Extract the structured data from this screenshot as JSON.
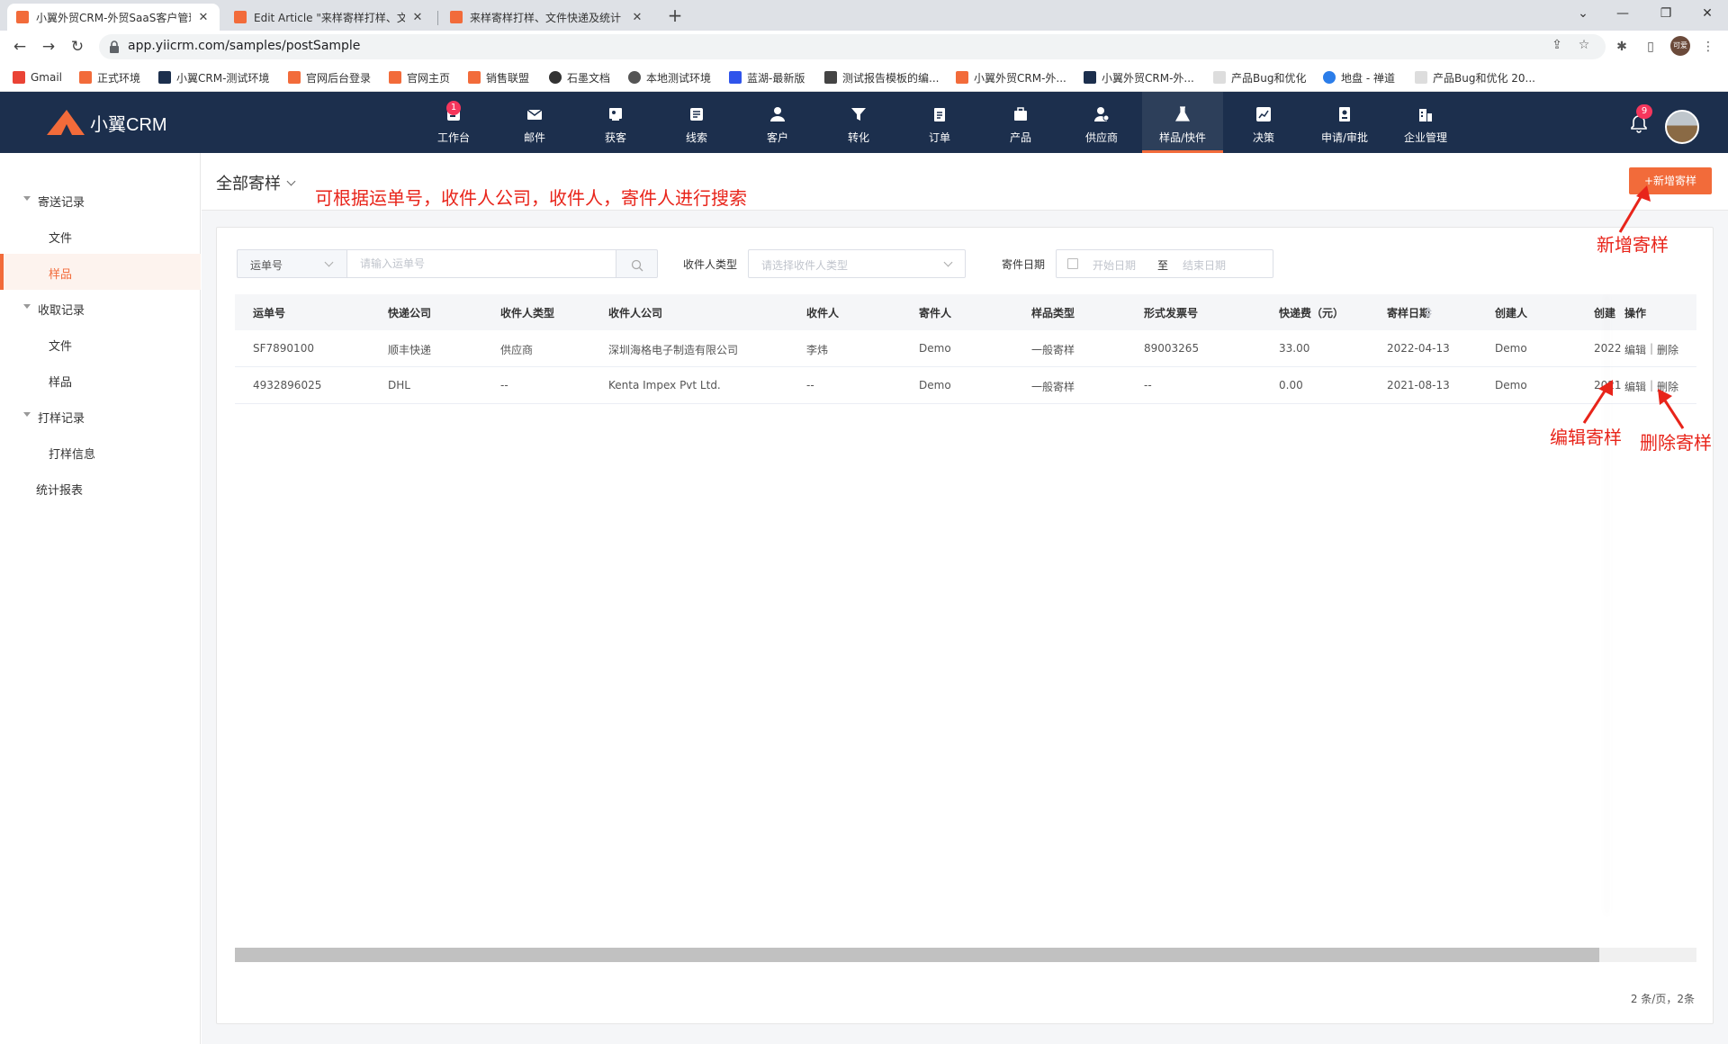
{
  "browser": {
    "tabs": [
      {
        "title": "小翼外贸CRM-外贸SaaS客户管理",
        "active": true
      },
      {
        "title": "Edit Article \"来样寄样打样、文件\"",
        "active": false
      },
      {
        "title": "来样寄样打样、文件快递及统计 -",
        "active": false
      }
    ],
    "new_tab": "+",
    "url": "app.yiicrm.com/samples/postSample",
    "profile_label": "可爱",
    "bookmarks": [
      {
        "label": "Gmail",
        "color": "#ea4335"
      },
      {
        "label": "正式环境",
        "color": "#f26b3a"
      },
      {
        "label": "小翼CRM-测试环境",
        "color": "#1c2f4d"
      },
      {
        "label": "官网后台登录",
        "color": "#f26b3a"
      },
      {
        "label": "官网主页",
        "color": "#f26b3a"
      },
      {
        "label": "销售联盟",
        "color": "#f26b3a"
      },
      {
        "label": "石墨文档",
        "color": "#333333"
      },
      {
        "label": "本地测试环境",
        "color": "#555555"
      },
      {
        "label": "蓝湖-最新版",
        "color": "#2f54eb"
      },
      {
        "label": "测试报告模板的编...",
        "color": "#444444"
      },
      {
        "label": "小翼外贸CRM-外...",
        "color": "#f26b3a"
      },
      {
        "label": "小翼外贸CRM-外...",
        "color": "#1c2f4d"
      },
      {
        "label": "产品Bug和优化",
        "color": "#dddddd"
      },
      {
        "label": "地盘 - 禅道",
        "color": "#2b7de9"
      },
      {
        "label": "产品Bug和优化 20...",
        "color": "#dddddd"
      }
    ]
  },
  "app": {
    "logo_text": "小翼CRM",
    "nav": [
      {
        "label": "工作台",
        "icon": "workbench-icon"
      },
      {
        "label": "邮件",
        "icon": "mail-icon"
      },
      {
        "label": "获客",
        "icon": "acquire-icon"
      },
      {
        "label": "线索",
        "icon": "lead-icon"
      },
      {
        "label": "客户",
        "icon": "customer-icon"
      },
      {
        "label": "转化",
        "icon": "funnel-icon"
      },
      {
        "label": "订单",
        "icon": "order-icon"
      },
      {
        "label": "产品",
        "icon": "product-icon"
      },
      {
        "label": "供应商",
        "icon": "supplier-icon"
      },
      {
        "label": "样品/快件",
        "icon": "flask-icon"
      },
      {
        "label": "决策",
        "icon": "chart-icon"
      },
      {
        "label": "申请/审批",
        "icon": "approval-icon"
      },
      {
        "label": "企业管理",
        "icon": "building-icon"
      }
    ],
    "nav_badge": "1",
    "bell_badge": "9",
    "accent": "#f26b3a",
    "header_bg": "#1c2f4d"
  },
  "sidebar": {
    "groups": [
      {
        "label": "寄送记录",
        "items": [
          "文件",
          "样品"
        ]
      },
      {
        "label": "收取记录",
        "items": [
          "文件",
          "样品"
        ]
      },
      {
        "label": "打样记录",
        "items": [
          "打样信息"
        ]
      }
    ],
    "extra": "统计报表"
  },
  "main": {
    "view_title": "全部寄样",
    "add_button": "+新增寄样",
    "annotations": {
      "search_hint": "可根据运单号，收件人公司，收件人，寄件人进行搜索",
      "add": "新增寄样",
      "edit": "编辑寄样",
      "delete": "删除寄样"
    },
    "filters": {
      "field_select": "运单号",
      "search_placeholder": "请输入运单号",
      "recipient_type_label": "收件人类型",
      "recipient_type_placeholder": "请选择收件人类型",
      "date_label": "寄件日期",
      "date_start": "开始日期",
      "date_to": "至",
      "date_end": "结束日期"
    },
    "table": {
      "columns": [
        "运单号",
        "快递公司",
        "收件人类型",
        "收件人公司",
        "收件人",
        "寄件人",
        "样品类型",
        "形式发票号",
        "快递费（元）",
        "寄样日期",
        "创建人",
        "创建",
        "操作"
      ],
      "rows": [
        [
          "SF7890100",
          "顺丰快递",
          "供应商",
          "深圳海格电子制造有限公司",
          "李炜",
          "Demo",
          "一般寄样",
          "89003265",
          "33.00",
          "2022-04-13",
          "Demo",
          "2022"
        ],
        [
          "4932896025",
          "DHL",
          "--",
          "Kenta Impex Pvt Ltd.",
          "--",
          "Demo",
          "一般寄样",
          "--",
          "0.00",
          "2021-08-13",
          "Demo",
          "2021"
        ]
      ],
      "op_edit": "编辑",
      "op_sep": "|",
      "op_delete": "删除"
    },
    "pagination": "2 条/页，2条"
  }
}
